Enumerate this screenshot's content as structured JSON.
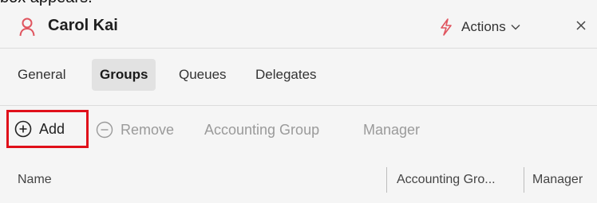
{
  "caption": "box appears.",
  "header": {
    "title": "Carol Kai",
    "actions_label": "Actions",
    "colors": {
      "person_icon": "#e0555f",
      "bolt_icon": "#e0555f"
    }
  },
  "tabs": [
    {
      "label": "General",
      "active": false
    },
    {
      "label": "Groups",
      "active": true
    },
    {
      "label": "Queues",
      "active": false
    },
    {
      "label": "Delegates",
      "active": false
    }
  ],
  "toolbar": {
    "add_label": "Add",
    "remove_label": "Remove",
    "accounting_group_label": "Accounting Group",
    "manager_label": "Manager",
    "highlight_color": "#e0101a"
  },
  "table": {
    "columns": [
      "Name",
      "Accounting Gro...",
      "Manager"
    ]
  }
}
